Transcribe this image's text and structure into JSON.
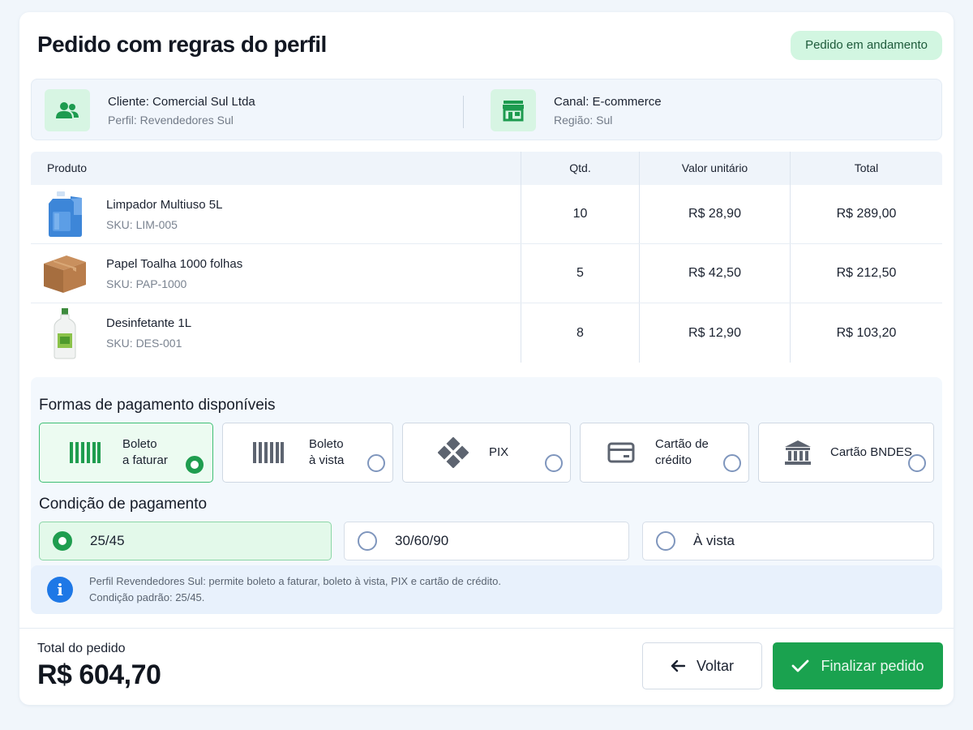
{
  "header": {
    "title": "Pedido com regras do perfil",
    "status": "Pedido em andamento"
  },
  "client": {
    "name": "Cliente: Comercial Sul Ltda",
    "profile": "Perfil: Revendedores Sul",
    "icon": "users-icon"
  },
  "channel": {
    "name": "Canal: E-commerce",
    "region": "Região: Sul",
    "icon": "store-icon"
  },
  "table": {
    "headers": [
      "Produto",
      "Qtd.",
      "Valor unitário",
      "Total"
    ],
    "rows": [
      {
        "name": "Limpador Multiuso 5L",
        "sku": "SKU: LIM-005",
        "qty": "10",
        "unit": "R$ 28,90",
        "total": "R$ 289,00",
        "image": "blue-jug-image"
      },
      {
        "name": "Papel Toalha 1000 folhas",
        "sku": "SKU: PAP-1000",
        "qty": "5",
        "unit": "R$ 42,50",
        "total": "R$ 212,50",
        "image": "cardboard-box-image"
      },
      {
        "name": "Desinfetante 1L",
        "sku": "SKU: DES-001",
        "qty": "8",
        "unit": "R$ 12,90",
        "total": "R$ 103,20",
        "image": "white-bottle-image"
      }
    ]
  },
  "payment": {
    "title": "Formas de pagamento disponíveis",
    "options": [
      {
        "label": "Boleto\na faturar",
        "icon": "barcode-icon",
        "selected": true
      },
      {
        "label": "Boleto\nà vista",
        "icon": "barcode-icon",
        "selected": false
      },
      {
        "label": "PIX",
        "icon": "pix-icon",
        "selected": false
      },
      {
        "label": "Cartão de\ncrédito",
        "icon": "credit-card-icon",
        "selected": false
      },
      {
        "label": "Cartão BNDES",
        "icon": "bank-icon",
        "selected": false
      }
    ]
  },
  "condition": {
    "title": "Condição de pagamento",
    "options": [
      {
        "label": "25/45",
        "selected": true
      },
      {
        "label": "30/60/90",
        "selected": false
      },
      {
        "label": "À vista",
        "selected": false
      }
    ]
  },
  "notice": {
    "line1": "Perfil Revendedores Sul: permite boleto a faturar, boleto à vista, PIX e cartão de crédito.",
    "line2": "Condição padrão: 25/45."
  },
  "footer": {
    "total_label": "Total do pedido",
    "total_value": "R$ 604,70",
    "back_label": "Voltar",
    "finish_label": "Finalizar pedido"
  },
  "colors": {
    "accent_green": "#1aa24f",
    "badge_bg": "#d2f6e1",
    "info_blue": "#1e78e6"
  }
}
